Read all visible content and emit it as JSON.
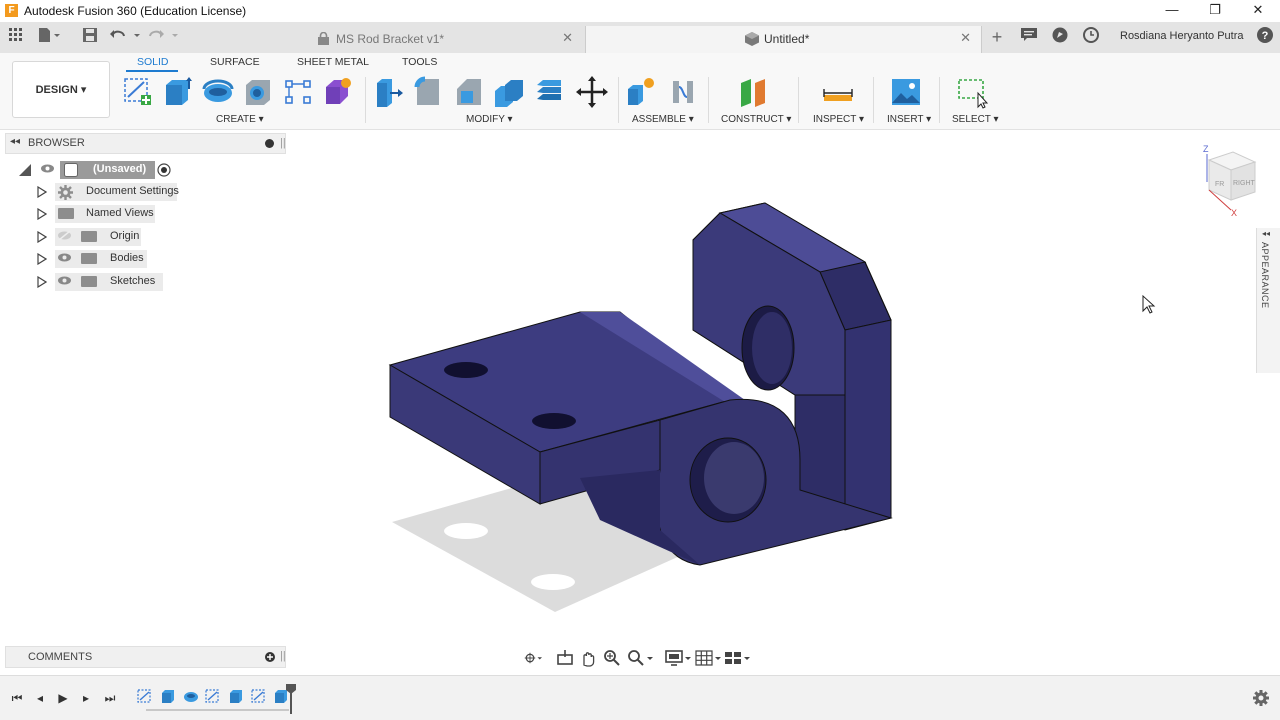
{
  "window": {
    "title": "Autodesk Fusion 360 (Education License)",
    "logo_letter": "F",
    "minimize": "—",
    "maximize": "❐",
    "close": "✕"
  },
  "tabs": [
    {
      "label": "MS Rod Bracket v1*",
      "active": false
    },
    {
      "label": "Untitled*",
      "active": true
    }
  ],
  "user": {
    "name": "Rosdiana Heryanto Putra"
  },
  "workspace": {
    "label": "DESIGN ▾"
  },
  "toolbar_tabs": [
    "SOLID",
    "SURFACE",
    "SHEET METAL",
    "TOOLS"
  ],
  "toolbar_groups": [
    "CREATE ▾",
    "MODIFY ▾",
    "ASSEMBLE ▾",
    "CONSTRUCT ▾",
    "INSPECT ▾",
    "INSERT ▾",
    "SELECT ▾"
  ],
  "browser": {
    "title": "BROWSER",
    "root": "(Unsaved)",
    "items": [
      "Document Settings",
      "Named Views",
      "Origin",
      "Bodies",
      "Sketches"
    ]
  },
  "comments": {
    "title": "COMMENTS"
  },
  "appearance": {
    "label": "APPEARANCE"
  },
  "viewcube": {
    "axis_z": "Z",
    "axis_x": "X",
    "front": "FR",
    "right": "RIGHT"
  },
  "colors": {
    "accent": "#1e7bd0",
    "model_body": "#3b3a78",
    "model_dark": "#2a2960",
    "model_light": "#5554a0"
  }
}
